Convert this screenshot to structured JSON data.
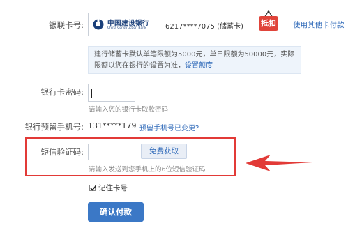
{
  "labels": {
    "bank_card": "银联卡号:",
    "card_password": "银行卡密码:",
    "reserved_phone": "银行预留手机号:",
    "sms_code": "短信验证码:"
  },
  "card": {
    "bank_name_cn": "中国建设银行",
    "bank_name_en": "China Construction Bank",
    "number": "6217****7075 (储蓄卡)"
  },
  "discount_badge": "抵扣",
  "other_card_link": "使用其他卡付款",
  "notice": {
    "text": "建行储蓄卡默认单笔限额为5000元，单日限额为50000元，实际限额以您在银行的设置为准，",
    "link": "设置额度"
  },
  "password": {
    "value": "",
    "hint": "请输入您的银行卡取款密码"
  },
  "phone": {
    "number": "131*****179",
    "change_link": "预留手机号已变更?"
  },
  "sms": {
    "value": "",
    "button": "免费获取",
    "hint": "请输入发送到您手机上的6位短信验证码"
  },
  "remember_card": {
    "label": "记住卡号",
    "checked": true
  },
  "confirm_button": "确认付款",
  "colors": {
    "link": "#2d68b8",
    "highlight_box": "#e23a37",
    "primary_button": "#3b78c6",
    "discount": "#e0443a"
  }
}
